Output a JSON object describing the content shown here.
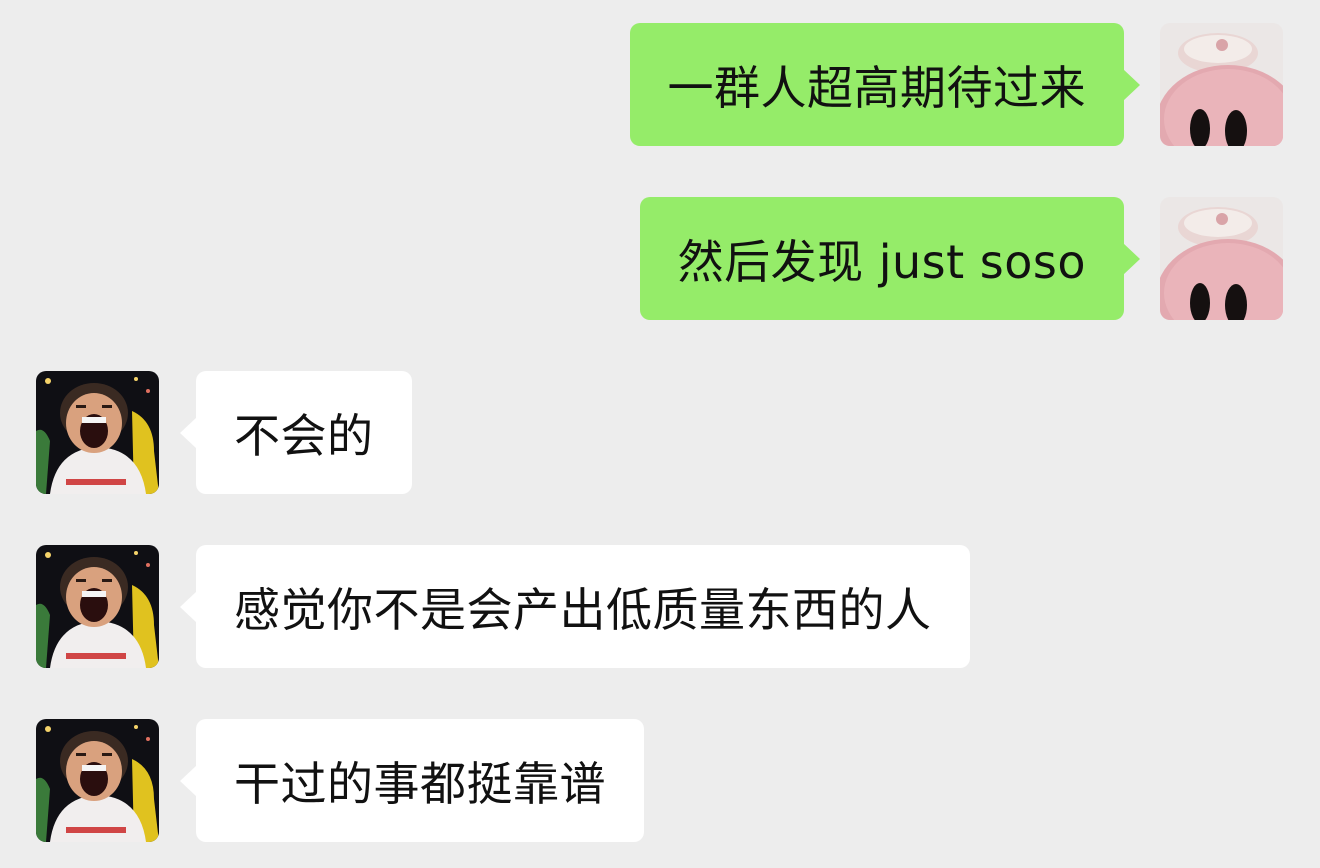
{
  "chat": {
    "messages": [
      {
        "sender": "me",
        "text": "一群人超高期待过来",
        "avatar_icon": "pink-pig-avatar-icon"
      },
      {
        "sender": "me",
        "text": "然后发现 just soso",
        "avatar_icon": "pink-pig-avatar-icon"
      },
      {
        "sender": "other",
        "text": "不会的",
        "avatar_icon": "screaming-person-avatar-icon"
      },
      {
        "sender": "other",
        "text": "感觉你不是会产出低质量东西的人",
        "avatar_icon": "screaming-person-avatar-icon"
      },
      {
        "sender": "other",
        "text": "干过的事都挺靠谱",
        "avatar_icon": "screaming-person-avatar-icon"
      }
    ]
  },
  "colors": {
    "background": "#ededed",
    "outgoing_bubble": "#95ec69",
    "incoming_bubble": "#ffffff",
    "text": "#111111"
  }
}
